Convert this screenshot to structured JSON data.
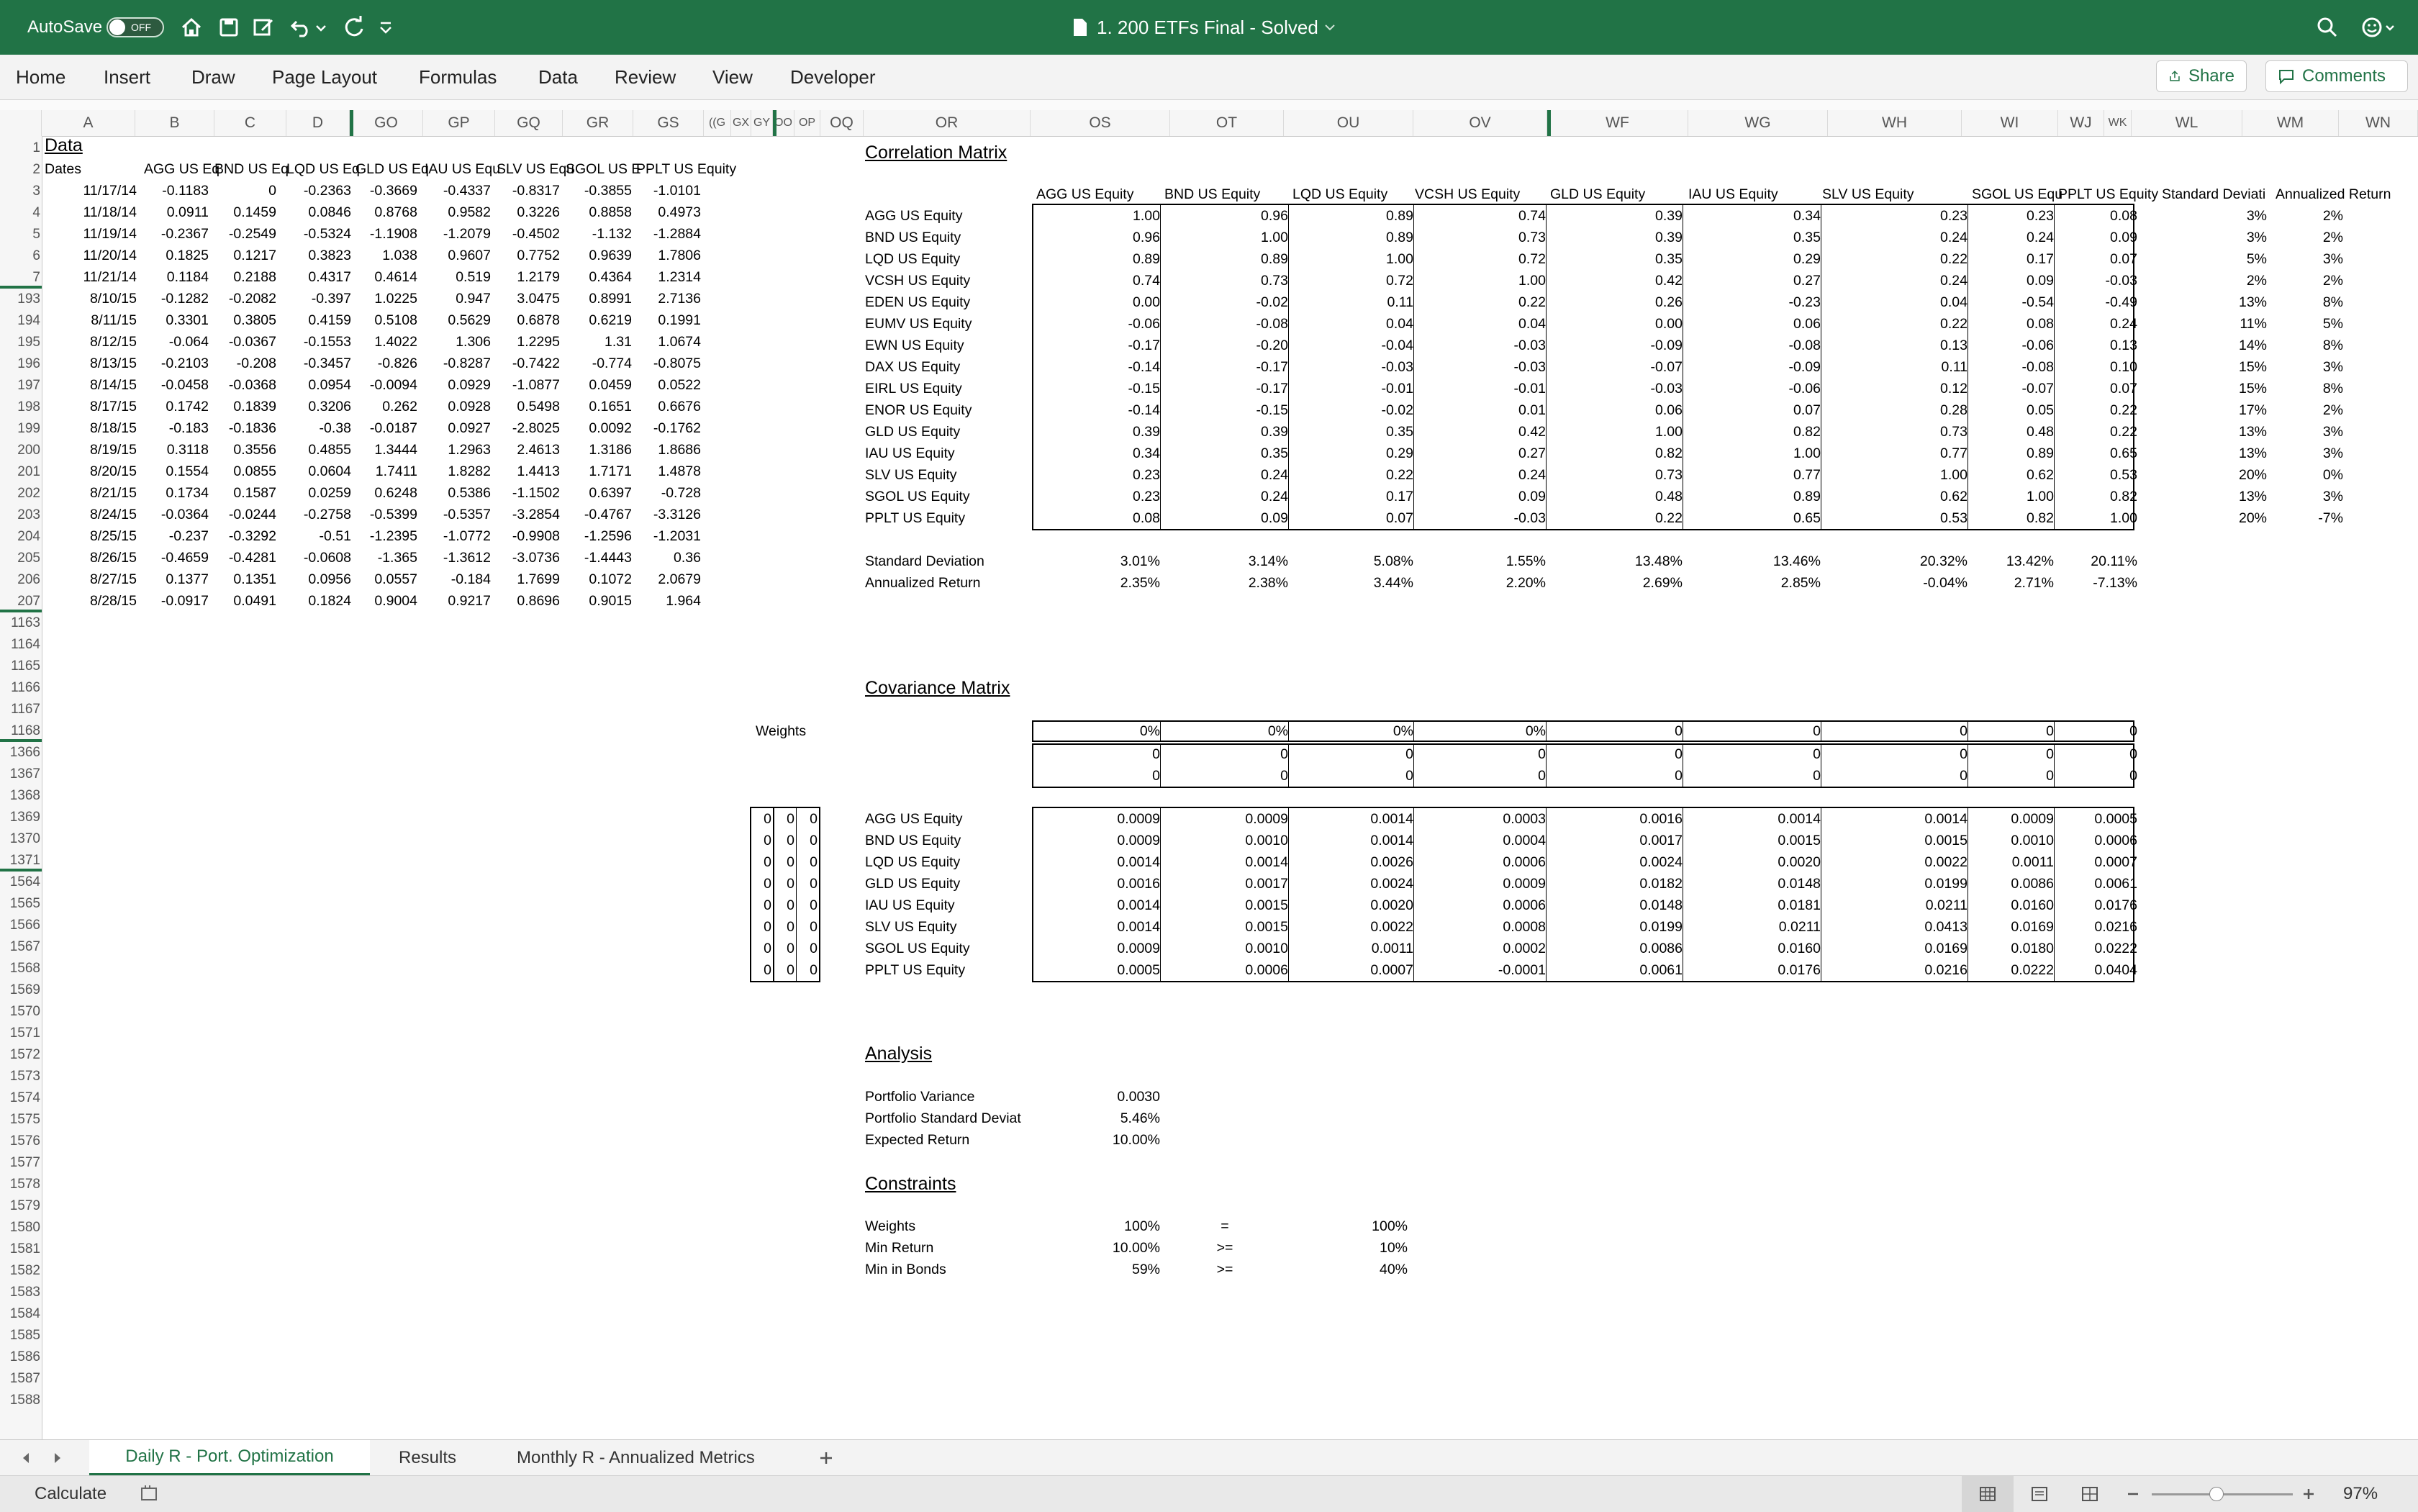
{
  "app": {
    "autosave_label": "AutoSave",
    "autosave_state": "OFF",
    "title": "1. 200 ETFs Final - Solved",
    "colors": {
      "accent": "#217346",
      "title_bar": "#217346"
    }
  },
  "ribbon": {
    "tabs": [
      "Home",
      "Insert",
      "Draw",
      "Page Layout",
      "Formulas",
      "Data",
      "Review",
      "View",
      "Developer"
    ],
    "share_label": "Share",
    "comments_label": "Comments"
  },
  "columns": [
    "A",
    "B",
    "C",
    "D",
    "GO",
    "GP",
    "GQ",
    "GR",
    "GS",
    "((G",
    "GX",
    "GY",
    "OO",
    "OP",
    "OQ",
    "OR",
    "OS",
    "OT",
    "OU",
    "OV",
    "WF",
    "WG",
    "WH",
    "WI",
    "WJ",
    "WK",
    "WL",
    "WM",
    "WN"
  ],
  "rows": [
    "1",
    "2",
    "3",
    "4",
    "5",
    "6",
    "7",
    "193",
    "194",
    "195",
    "196",
    "197",
    "198",
    "199",
    "200",
    "201",
    "202",
    "203",
    "204",
    "205",
    "206",
    "207",
    "1163",
    "1164",
    "1165",
    "1166",
    "1167",
    "1168",
    "1366",
    "1367",
    "1368",
    "1369",
    "1370",
    "1371",
    "1564",
    "1565",
    "1566",
    "1567",
    "1568",
    "1569",
    "1570",
    "1571",
    "1572",
    "1573",
    "1574",
    "1575",
    "1576",
    "1577",
    "1578",
    "1579",
    "1580",
    "1581",
    "1582",
    "1583",
    "1584",
    "1585",
    "1586",
    "1587",
    "1588"
  ],
  "data_section": {
    "title": "Data",
    "dates_label": "Dates",
    "headers": [
      "AGG US Eq",
      "BND US Eq",
      "LQD US Eq",
      "GLD US Eq",
      "IAU US Equ",
      "SLV US Equ",
      "SGOL US E",
      "PPLT US Equity"
    ],
    "rows": [
      [
        "11/17/14",
        "-0.1183",
        "0",
        "-0.2363",
        "-0.3669",
        "-0.4337",
        "-0.8317",
        "-0.3855",
        "-1.0101"
      ],
      [
        "11/18/14",
        "0.0911",
        "0.1459",
        "0.0846",
        "0.8768",
        "0.9582",
        "0.3226",
        "0.8858",
        "0.4973"
      ],
      [
        "11/19/14",
        "-0.2367",
        "-0.2549",
        "-0.5324",
        "-1.1908",
        "-1.2079",
        "-0.4502",
        "-1.132",
        "-1.2884"
      ],
      [
        "11/20/14",
        "0.1825",
        "0.1217",
        "0.3823",
        "1.038",
        "0.9607",
        "0.7752",
        "0.9639",
        "1.7806"
      ],
      [
        "11/21/14",
        "0.1184",
        "0.2188",
        "0.4317",
        "0.4614",
        "0.519",
        "1.2179",
        "0.4364",
        "1.2314"
      ],
      [
        "8/10/15",
        "-0.1282",
        "-0.2082",
        "-0.397",
        "1.0225",
        "0.947",
        "3.0475",
        "0.8991",
        "2.7136"
      ],
      [
        "8/11/15",
        "0.3301",
        "0.3805",
        "0.4159",
        "0.5108",
        "0.5629",
        "0.6878",
        "0.6219",
        "0.1991"
      ],
      [
        "8/12/15",
        "-0.064",
        "-0.0367",
        "-0.1553",
        "1.4022",
        "1.306",
        "1.2295",
        "1.31",
        "1.0674"
      ],
      [
        "8/13/15",
        "-0.2103",
        "-0.208",
        "-0.3457",
        "-0.826",
        "-0.8287",
        "-0.7422",
        "-0.774",
        "-0.8075"
      ],
      [
        "8/14/15",
        "-0.0458",
        "-0.0368",
        "0.0954",
        "-0.0094",
        "0.0929",
        "-1.0877",
        "0.0459",
        "0.0522"
      ],
      [
        "8/17/15",
        "0.1742",
        "0.1839",
        "0.3206",
        "0.262",
        "0.0928",
        "0.5498",
        "0.1651",
        "0.6676"
      ],
      [
        "8/18/15",
        "-0.183",
        "-0.1836",
        "-0.38",
        "-0.0187",
        "0.0927",
        "-2.8025",
        "0.0092",
        "-0.1762"
      ],
      [
        "8/19/15",
        "0.3118",
        "0.3556",
        "0.4855",
        "1.3444",
        "1.2963",
        "2.4613",
        "1.3186",
        "1.8686"
      ],
      [
        "8/20/15",
        "0.1554",
        "0.0855",
        "0.0604",
        "1.7411",
        "1.8282",
        "1.4413",
        "1.7171",
        "1.4878"
      ],
      [
        "8/21/15",
        "0.1734",
        "0.1587",
        "0.0259",
        "0.6248",
        "0.5386",
        "-1.1502",
        "0.6397",
        "-0.728"
      ],
      [
        "8/24/15",
        "-0.0364",
        "-0.0244",
        "-0.2758",
        "-0.5399",
        "-0.5357",
        "-3.2854",
        "-0.4767",
        "-3.3126"
      ],
      [
        "8/25/15",
        "-0.237",
        "-0.3292",
        "-0.51",
        "-1.2395",
        "-1.0772",
        "-0.9908",
        "-1.2596",
        "-1.2031"
      ],
      [
        "8/26/15",
        "-0.4659",
        "-0.4281",
        "-0.0608",
        "-1.365",
        "-1.3612",
        "-3.0736",
        "-1.4443",
        "0.36"
      ],
      [
        "8/27/15",
        "0.1377",
        "0.1351",
        "0.0956",
        "0.0557",
        "-0.184",
        "1.7699",
        "0.1072",
        "2.0679"
      ],
      [
        "8/28/15",
        "-0.0917",
        "0.0491",
        "0.1824",
        "0.9004",
        "0.9217",
        "0.8696",
        "0.9015",
        "1.964"
      ]
    ]
  },
  "correlation": {
    "title": "Correlation Matrix",
    "col_headers": [
      "AGG US Equity",
      "BND US Equity",
      "LQD US Equity",
      "VCSH US Equity",
      "GLD US Equity",
      "IAU US Equity",
      "SLV US Equity",
      "SGOL US Equ",
      "PPLT US Equity",
      "Standard Deviati",
      "Annualized Return"
    ],
    "rows": [
      {
        "label": "AGG US Equity",
        "values": [
          "1.00",
          "0.96",
          "0.89",
          "0.74",
          "0.39",
          "0.34",
          "0.23",
          "0.23",
          "0.08"
        ],
        "sd": "3%",
        "ret": "2%"
      },
      {
        "label": "BND US Equity",
        "values": [
          "0.96",
          "1.00",
          "0.89",
          "0.73",
          "0.39",
          "0.35",
          "0.24",
          "0.24",
          "0.09"
        ],
        "sd": "3%",
        "ret": "2%"
      },
      {
        "label": "LQD US Equity",
        "values": [
          "0.89",
          "0.89",
          "1.00",
          "0.72",
          "0.35",
          "0.29",
          "0.22",
          "0.17",
          "0.07"
        ],
        "sd": "5%",
        "ret": "3%"
      },
      {
        "label": "VCSH US Equity",
        "values": [
          "0.74",
          "0.73",
          "0.72",
          "1.00",
          "0.42",
          "0.27",
          "0.24",
          "0.09",
          "-0.03"
        ],
        "sd": "2%",
        "ret": "2%"
      },
      {
        "label": "EDEN US Equity",
        "values": [
          "0.00",
          "-0.02",
          "0.11",
          "0.22",
          "0.26",
          "-0.23",
          "0.04",
          "-0.54",
          "-0.49"
        ],
        "sd": "13%",
        "ret": "8%"
      },
      {
        "label": "EUMV US Equity",
        "values": [
          "-0.06",
          "-0.08",
          "0.04",
          "0.04",
          "0.00",
          "0.06",
          "0.22",
          "0.08",
          "0.24"
        ],
        "sd": "11%",
        "ret": "5%"
      },
      {
        "label": "EWN US Equity",
        "values": [
          "-0.17",
          "-0.20",
          "-0.04",
          "-0.03",
          "-0.09",
          "-0.08",
          "0.13",
          "-0.06",
          "0.13"
        ],
        "sd": "14%",
        "ret": "8%"
      },
      {
        "label": "DAX US Equity",
        "values": [
          "-0.14",
          "-0.17",
          "-0.03",
          "-0.03",
          "-0.07",
          "-0.09",
          "0.11",
          "-0.08",
          "0.10"
        ],
        "sd": "15%",
        "ret": "3%"
      },
      {
        "label": "EIRL US Equity",
        "values": [
          "-0.15",
          "-0.17",
          "-0.01",
          "-0.01",
          "-0.03",
          "-0.06",
          "0.12",
          "-0.07",
          "0.07"
        ],
        "sd": "15%",
        "ret": "8%"
      },
      {
        "label": "ENOR US Equity",
        "values": [
          "-0.14",
          "-0.15",
          "-0.02",
          "0.01",
          "0.06",
          "0.07",
          "0.28",
          "0.05",
          "0.22"
        ],
        "sd": "17%",
        "ret": "2%"
      },
      {
        "label": "GLD US Equity",
        "values": [
          "0.39",
          "0.39",
          "0.35",
          "0.42",
          "1.00",
          "0.82",
          "0.73",
          "0.48",
          "0.22"
        ],
        "sd": "13%",
        "ret": "3%"
      },
      {
        "label": "IAU US Equity",
        "values": [
          "0.34",
          "0.35",
          "0.29",
          "0.27",
          "0.82",
          "1.00",
          "0.77",
          "0.89",
          "0.65"
        ],
        "sd": "13%",
        "ret": "3%"
      },
      {
        "label": "SLV US Equity",
        "values": [
          "0.23",
          "0.24",
          "0.22",
          "0.24",
          "0.73",
          "0.77",
          "1.00",
          "0.62",
          "0.53"
        ],
        "sd": "20%",
        "ret": "0%"
      },
      {
        "label": "SGOL US Equity",
        "values": [
          "0.23",
          "0.24",
          "0.17",
          "0.09",
          "0.48",
          "0.89",
          "0.62",
          "1.00",
          "0.82"
        ],
        "sd": "13%",
        "ret": "3%"
      },
      {
        "label": "PPLT US Equity",
        "values": [
          "0.08",
          "0.09",
          "0.07",
          "-0.03",
          "0.22",
          "0.65",
          "0.53",
          "0.82",
          "1.00"
        ],
        "sd": "20%",
        "ret": "-7%"
      }
    ],
    "std_label": "Standard Deviation",
    "std_values": [
      "3.01%",
      "3.14%",
      "5.08%",
      "1.55%",
      "13.48%",
      "13.46%",
      "20.32%",
      "13.42%",
      "20.11%"
    ],
    "ret_label": "Annualized Return",
    "ret_values": [
      "2.35%",
      "2.38%",
      "3.44%",
      "2.20%",
      "2.69%",
      "2.85%",
      "-0.04%",
      "2.71%",
      "-7.13%"
    ]
  },
  "covariance": {
    "title": "Covariance Matrix",
    "weights_label": "Weights",
    "weights_row": [
      "0%",
      "0%",
      "0%",
      "0%",
      "0",
      "0",
      "0",
      "0",
      "0"
    ],
    "zero_rows": [
      [
        "0",
        "0",
        "0",
        "0",
        "0",
        "0",
        "0",
        "0",
        "0"
      ],
      [
        "0",
        "0",
        "0",
        "0",
        "0",
        "0",
        "0",
        "0",
        "0"
      ]
    ],
    "left_weights": [
      [
        "0",
        "0",
        "0"
      ],
      [
        "0",
        "0",
        "0"
      ],
      [
        "0",
        "0",
        "0"
      ],
      [
        "0",
        "0",
        "0"
      ],
      [
        "0",
        "0",
        "0"
      ],
      [
        "0",
        "0",
        "0"
      ],
      [
        "0",
        "0",
        "0"
      ],
      [
        "0",
        "0",
        "0"
      ]
    ],
    "rows": [
      {
        "label": "AGG US Equity",
        "values": [
          "0.0009",
          "0.0009",
          "0.0014",
          "0.0003",
          "0.0016",
          "0.0014",
          "0.0014",
          "0.0009",
          "0.0005"
        ]
      },
      {
        "label": "BND US Equity",
        "values": [
          "0.0009",
          "0.0010",
          "0.0014",
          "0.0004",
          "0.0017",
          "0.0015",
          "0.0015",
          "0.0010",
          "0.0006"
        ]
      },
      {
        "label": "LQD US Equity",
        "values": [
          "0.0014",
          "0.0014",
          "0.0026",
          "0.0006",
          "0.0024",
          "0.0020",
          "0.0022",
          "0.0011",
          "0.0007"
        ]
      },
      {
        "label": "GLD US Equity",
        "values": [
          "0.0016",
          "0.0017",
          "0.0024",
          "0.0009",
          "0.0182",
          "0.0148",
          "0.0199",
          "0.0086",
          "0.0061"
        ]
      },
      {
        "label": "IAU US Equity",
        "values": [
          "0.0014",
          "0.0015",
          "0.0020",
          "0.0006",
          "0.0148",
          "0.0181",
          "0.0211",
          "0.0160",
          "0.0176"
        ]
      },
      {
        "label": "SLV US Equity",
        "values": [
          "0.0014",
          "0.0015",
          "0.0022",
          "0.0008",
          "0.0199",
          "0.0211",
          "0.0413",
          "0.0169",
          "0.0216"
        ]
      },
      {
        "label": "SGOL US Equity",
        "values": [
          "0.0009",
          "0.0010",
          "0.0011",
          "0.0002",
          "0.0086",
          "0.0160",
          "0.0169",
          "0.0180",
          "0.0222"
        ]
      },
      {
        "label": "PPLT US Equity",
        "values": [
          "0.0005",
          "0.0006",
          "0.0007",
          "-0.0001",
          "0.0061",
          "0.0176",
          "0.0216",
          "0.0222",
          "0.0404"
        ]
      }
    ]
  },
  "analysis": {
    "title": "Analysis",
    "rows": [
      {
        "label": "Portfolio Variance",
        "value": "0.0030"
      },
      {
        "label": "Portfolio Standard Deviat",
        "value": "5.46%"
      },
      {
        "label": "Expected Return",
        "value": "10.00%"
      }
    ]
  },
  "constraints": {
    "title": "Constraints",
    "rows": [
      {
        "label": "Weights",
        "value": "100%",
        "op": "=",
        "target": "100%"
      },
      {
        "label": "Min Return",
        "value": "10.00%",
        "op": ">=",
        "target": "10%"
      },
      {
        "label": "Min in Bonds",
        "value": "59%",
        "op": ">=",
        "target": "40%"
      }
    ]
  },
  "sheet_tabs": [
    "Daily R - Port. Optimization",
    "Results",
    "Monthly R - Annualized Metrics"
  ],
  "status": {
    "left": "Calculate",
    "zoom": "97%"
  }
}
